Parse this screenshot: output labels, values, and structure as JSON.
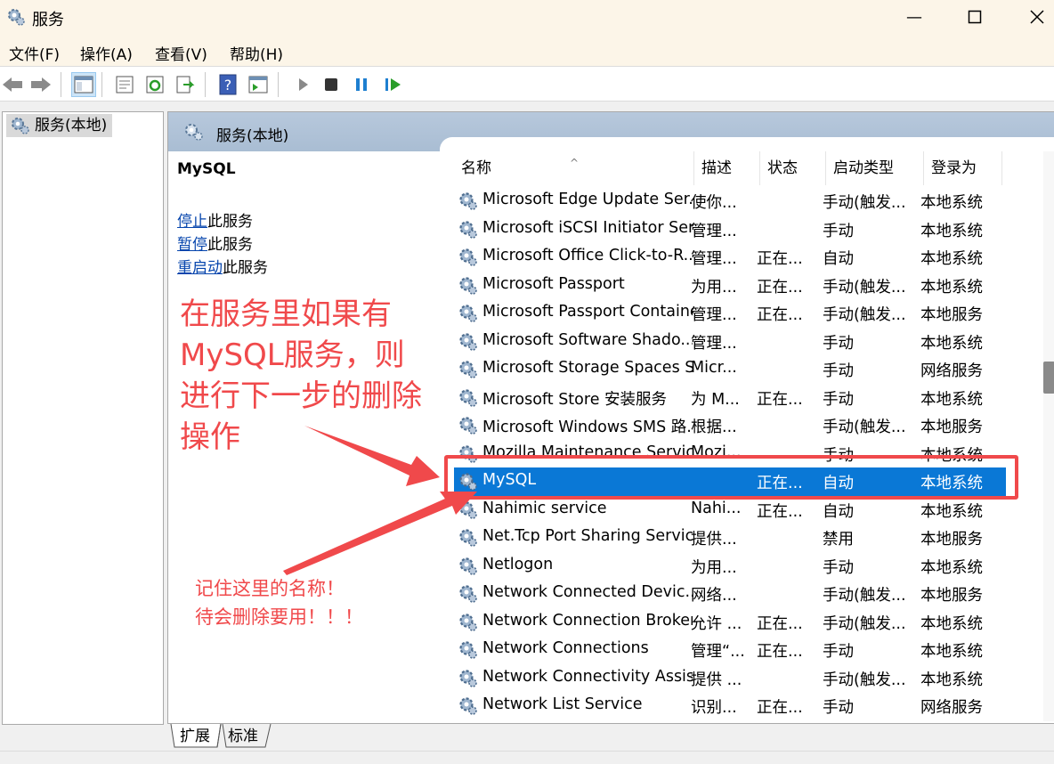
{
  "window": {
    "title": "服务"
  },
  "menu": [
    "文件(F)",
    "操作(A)",
    "查看(V)",
    "帮助(H)"
  ],
  "toolbar": {
    "icons": [
      "back-icon",
      "forward-icon",
      "show-tree-icon",
      "properties-icon",
      "refresh-icon",
      "export-icon",
      "help-icon",
      "action-pane-icon",
      "start-icon",
      "stop-icon",
      "pause-icon",
      "resume-icon"
    ]
  },
  "tree": {
    "root": "服务(本地)"
  },
  "pane": {
    "header": "服务(本地)",
    "selected_name": "MySQL",
    "actions": [
      {
        "link": "停止",
        "rest": "此服务"
      },
      {
        "link": "暂停",
        "rest": "此服务"
      },
      {
        "link": "重启动",
        "rest": "此服务"
      }
    ]
  },
  "columns": [
    "名称",
    "描述",
    "状态",
    "启动类型",
    "登录为"
  ],
  "rows": [
    {
      "name": "Microsoft Edge Update Ser...",
      "desc": "使你...",
      "status": "",
      "startup": "手动(触发...",
      "logon": "本地系统"
    },
    {
      "name": "Microsoft iSCSI Initiator Ser...",
      "desc": "管理...",
      "status": "",
      "startup": "手动",
      "logon": "本地系统"
    },
    {
      "name": "Microsoft Office Click-to-R...",
      "desc": "管理...",
      "status": "正在...",
      "startup": "自动",
      "logon": "本地系统"
    },
    {
      "name": "Microsoft Passport",
      "desc": "为用...",
      "status": "正在...",
      "startup": "手动(触发...",
      "logon": "本地系统"
    },
    {
      "name": "Microsoft Passport Container",
      "desc": "管理...",
      "status": "正在...",
      "startup": "手动(触发...",
      "logon": "本地服务"
    },
    {
      "name": "Microsoft Software Shado...",
      "desc": "管理...",
      "status": "",
      "startup": "手动",
      "logon": "本地系统"
    },
    {
      "name": "Microsoft Storage Spaces S...",
      "desc": "Micr...",
      "status": "",
      "startup": "手动",
      "logon": "网络服务"
    },
    {
      "name": "Microsoft Store 安装服务",
      "desc": "为 M...",
      "status": "正在...",
      "startup": "手动",
      "logon": "本地系统"
    },
    {
      "name": "Microsoft Windows SMS 路...",
      "desc": "根据...",
      "status": "",
      "startup": "手动(触发...",
      "logon": "本地服务"
    },
    {
      "name": "Mozilla Maintenance Service",
      "desc": "Mozi...",
      "status": "",
      "startup": "手动",
      "logon": "本地系统"
    },
    {
      "name": "MySQL",
      "desc": "",
      "status": "正在...",
      "startup": "自动",
      "logon": "本地系统",
      "selected": true
    },
    {
      "name": "Nahimic service",
      "desc": "Nahi...",
      "status": "正在...",
      "startup": "自动",
      "logon": "本地系统"
    },
    {
      "name": "Net.Tcp Port Sharing Service",
      "desc": "提供...",
      "status": "",
      "startup": "禁用",
      "logon": "本地服务"
    },
    {
      "name": "Netlogon",
      "desc": "为用...",
      "status": "",
      "startup": "手动",
      "logon": "本地系统"
    },
    {
      "name": "Network Connected Devic...",
      "desc": "网络...",
      "status": "",
      "startup": "手动(触发...",
      "logon": "本地服务"
    },
    {
      "name": "Network Connection Broker",
      "desc": "允许 ...",
      "status": "正在...",
      "startup": "手动(触发...",
      "logon": "本地系统"
    },
    {
      "name": "Network Connections",
      "desc": "管理“...",
      "status": "正在...",
      "startup": "手动",
      "logon": "本地系统"
    },
    {
      "name": "Network Connectivity Assis...",
      "desc": "提供 ...",
      "status": "",
      "startup": "手动(触发...",
      "logon": "本地系统"
    },
    {
      "name": "Network List Service",
      "desc": "识别...",
      "status": "正在...",
      "startup": "手动",
      "logon": "网络服务"
    }
  ],
  "tabs": [
    "扩展",
    "标准"
  ],
  "annotations": {
    "big": [
      "在服务里如果有",
      "MySQL服务，则",
      "进行下一步的删除",
      "操作"
    ],
    "small": [
      "记住这里的名称！",
      "待会删除要用！！！"
    ],
    "color": "#f0494b"
  },
  "colors": {
    "selection": "#0a78d6",
    "pane_header": "#afc2d8",
    "title_bar": "#fcf5e8"
  }
}
